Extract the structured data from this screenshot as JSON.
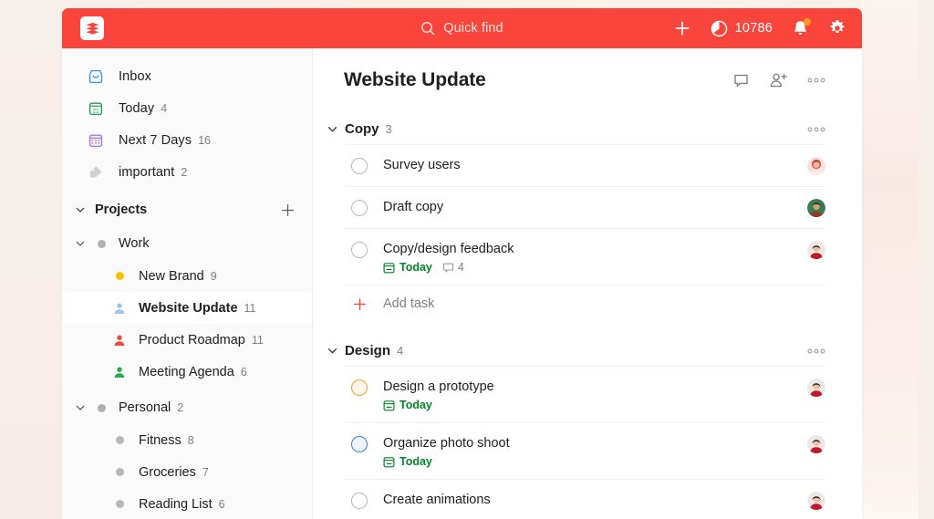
{
  "topbar": {
    "logo_name": "todoist-logo",
    "search_placeholder": "Quick find",
    "add_label": "+",
    "karma_value": "10786",
    "icons": [
      "plus-icon",
      "karma-icon",
      "bell-icon",
      "gear-icon"
    ]
  },
  "sidebar": {
    "nav": [
      {
        "label": "Inbox",
        "count": "",
        "icon": "inbox-icon"
      },
      {
        "label": "Today",
        "count": "4",
        "icon": "calendar-today-icon"
      },
      {
        "label": "Next 7 Days",
        "count": "16",
        "icon": "calendar-week-icon"
      },
      {
        "label": "important",
        "count": "2",
        "icon": "label-tag-icon"
      }
    ],
    "projects_header": {
      "label": "Projects",
      "add_label": "+"
    },
    "groups": [
      {
        "label": "Work",
        "count": "",
        "dot_color": "#b0b0b0",
        "items": [
          {
            "label": "New Brand",
            "count": "9",
            "icon": "dot",
            "color": "#f9c300",
            "selected": false
          },
          {
            "label": "Website Update",
            "count": "11",
            "icon": "person-shared",
            "color": "#9cc8ee",
            "selected": true
          },
          {
            "label": "Product Roadmap",
            "count": "11",
            "icon": "person-shared",
            "color": "#ec4b3f",
            "selected": false
          },
          {
            "label": "Meeting Agenda",
            "count": "6",
            "icon": "person-shared",
            "color": "#2ea84f",
            "selected": false
          }
        ]
      },
      {
        "label": "Personal",
        "count": "2",
        "dot_color": "#b0b0b0",
        "items": [
          {
            "label": "Fitness",
            "count": "8",
            "icon": "dot",
            "color": "#b7b7b7",
            "selected": false
          },
          {
            "label": "Groceries",
            "count": "7",
            "icon": "dot",
            "color": "#b7b7b7",
            "selected": false
          },
          {
            "label": "Reading List",
            "count": "6",
            "icon": "dot",
            "color": "#b7b7b7",
            "selected": false
          }
        ]
      }
    ]
  },
  "content": {
    "title": "Website Update",
    "header_actions": [
      "comment-icon",
      "add-person-icon",
      "more-options-icon"
    ],
    "sections": [
      {
        "name": "Copy",
        "count": "3",
        "tasks": [
          {
            "title": "Survey users",
            "priority": "none",
            "date": "",
            "comments": "",
            "avatar": "avatar-red"
          },
          {
            "title": "Draft copy",
            "priority": "none",
            "date": "",
            "comments": "",
            "avatar": "avatar-green"
          },
          {
            "title": "Copy/design feedback",
            "priority": "none",
            "date": "Today",
            "comments": "4",
            "avatar": "avatar-dark"
          }
        ],
        "add_task_label": "Add task"
      },
      {
        "name": "Design",
        "count": "4",
        "tasks": [
          {
            "title": "Design a prototype",
            "priority": "p3",
            "date": "Today",
            "comments": "",
            "avatar": "avatar-dark"
          },
          {
            "title": "Organize photo shoot",
            "priority": "p4",
            "date": "Today",
            "comments": "",
            "avatar": "avatar-dark"
          },
          {
            "title": "Create animations",
            "priority": "none",
            "date": "",
            "comments": "",
            "avatar": "avatar-dark"
          }
        ],
        "add_task_label": "Add task"
      }
    ]
  },
  "colors": {
    "brand_red": "#f9453c",
    "accent_green": "#058527",
    "priority_orange": "#eba333",
    "priority_blue": "#3b82d6",
    "notification_orange": "#ff9a1f"
  }
}
